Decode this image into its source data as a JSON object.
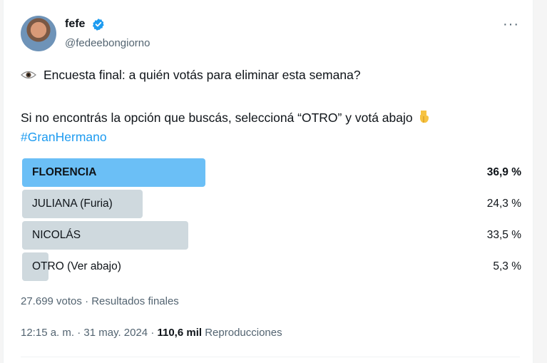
{
  "tweet": {
    "author_name": "fefe",
    "author_handle": "@fedeebongiorno",
    "more_label": "···",
    "line1": "Encuesta final: a quién votás para eliminar esta semana?",
    "line2": "Si no encontrás la opción que buscás, seleccioná “OTRO” y votá abajo",
    "hashtag": "#GranHermano"
  },
  "poll": {
    "options": [
      {
        "label": "FLORENCIA",
        "percent": "36,9 %",
        "fraction": 0.369,
        "winner": true
      },
      {
        "label": "JULIANA (Furia)",
        "percent": "24,3 %",
        "fraction": 0.243,
        "winner": false
      },
      {
        "label": "NICOLÁS",
        "percent": "33,5 %",
        "fraction": 0.335,
        "winner": false
      },
      {
        "label": "OTRO (Ver abajo)",
        "percent": "5,3 %",
        "fraction": 0.053,
        "winner": false
      }
    ],
    "summary": "27.699 votos · Resultados finales"
  },
  "footer": {
    "time": "12:15 a. m. · 31 may. 2024 · ",
    "views_count": "110,6 mil",
    "views_label": " Reproducciones"
  },
  "colors": {
    "winner_bar": "#6bbff6",
    "bar": "#cfd9de",
    "link": "#1d9bf0",
    "verified": "#1d9bf0"
  },
  "icons": {
    "verified": "verified-badge-icon",
    "eye": "eye-icon",
    "hand": "hand-pointing-down-icon",
    "more": "more-icon"
  }
}
